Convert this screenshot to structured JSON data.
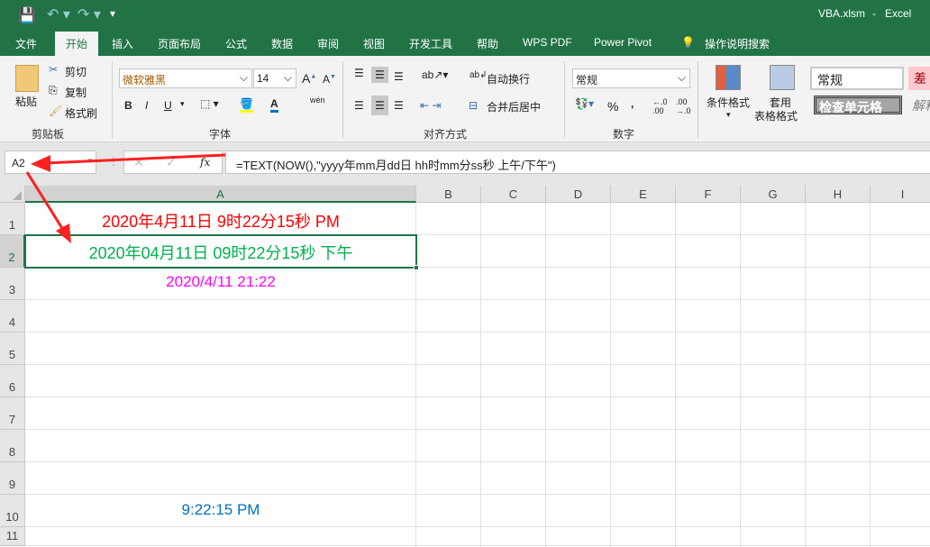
{
  "titlebar": {
    "filename": "VBA.xlsm",
    "app": "Excel"
  },
  "tabs": [
    "文件",
    "开始",
    "插入",
    "页面布局",
    "公式",
    "数据",
    "审阅",
    "视图",
    "开发工具",
    "帮助",
    "WPS PDF",
    "Power Pivot",
    "操作说明搜索"
  ],
  "ribbon": {
    "clipboard": {
      "paste": "粘贴",
      "cut": "剪切",
      "copy": "复制",
      "format_painter": "格式刷",
      "label": "剪贴板"
    },
    "font": {
      "name": "微软雅黑",
      "size": "14",
      "bold": "B",
      "italic": "I",
      "underline": "U",
      "phonetic": "wén",
      "label": "字体"
    },
    "alignment": {
      "wrap": "自动换行",
      "merge": "合并后居中",
      "label": "对齐方式"
    },
    "number": {
      "format": "常规",
      "percent": "%",
      "comma": ",",
      "label": "数字"
    },
    "styles": {
      "conditional": "条件格式",
      "table1": "套用",
      "table2": "表格格式",
      "normal": "常规",
      "bad": "差",
      "check": "检查单元格",
      "explain": "解释"
    }
  },
  "formula_bar": {
    "name_box": "A2",
    "fx": "fx",
    "formula": "=TEXT(NOW(),\"yyyy年mm月dd日 hh时mm分ss秒 上午/下午\")"
  },
  "columns": [
    "A",
    "B",
    "C",
    "D",
    "E",
    "F",
    "G",
    "H",
    "I"
  ],
  "rows": [
    "1",
    "2",
    "3",
    "4",
    "5",
    "6",
    "7",
    "8",
    "9",
    "10",
    "11"
  ],
  "cells": {
    "A1": {
      "value": "2020年4月11日 9时22分15秒 PM",
      "color": "#ff0000"
    },
    "A2": {
      "value": "2020年04月11日 09时22分15秒 下午",
      "color": "#00b050"
    },
    "A3": {
      "value": "2020/4/11 21:22",
      "color": "#ff00ff"
    },
    "A10": {
      "value": "9:22:15 PM",
      "color": "#0070c0"
    }
  },
  "colors": {
    "accent": "#217346",
    "annotation_arrow": "#ff2020"
  }
}
